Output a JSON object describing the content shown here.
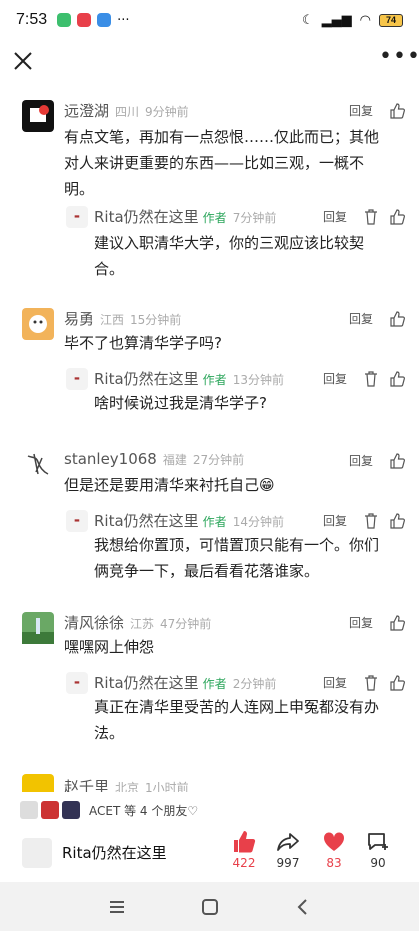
{
  "status": {
    "time": "7:53",
    "battery": "74"
  },
  "comments": [
    {
      "name": "远澄湖",
      "location": "四川",
      "time": "9分钟前",
      "reply_label": "回复",
      "text": [
        "有点文笔，再加有一点怨恨……仅此而已；其他",
        "对人来讲更重要的东西——比如三观，一概不",
        "明。"
      ],
      "reply": {
        "name": "Rita仍然在这里",
        "tag": "作者",
        "time": "7分钟前",
        "reply_label": "回复",
        "text": [
          "建议入职清华大学，你的三观应该比较契",
          "合。"
        ]
      }
    },
    {
      "name": "易勇",
      "location": "江西",
      "time": "15分钟前",
      "reply_label": "回复",
      "text": [
        "毕不了也算清华学子吗?"
      ],
      "reply": {
        "name": "Rita仍然在这里",
        "tag": "作者",
        "time": "13分钟前",
        "reply_label": "回复",
        "text": [
          "啥时候说过我是清华学子?"
        ]
      }
    },
    {
      "name": "stanley1068",
      "location": "福建",
      "time": "27分钟前",
      "reply_label": "回复",
      "text": [
        "但是还是要用清华来衬托自己😁"
      ],
      "reply": {
        "name": "Rita仍然在这里",
        "tag": "作者",
        "time": "14分钟前",
        "reply_label": "回复",
        "text": [
          "我想给你置顶，可惜置顶只能有一个。你们",
          "俩竞争一下，最后看看花落谁家。"
        ]
      }
    },
    {
      "name": "清风徐徐",
      "location": "江苏",
      "time": "47分钟前",
      "reply_label": "回复",
      "text": [
        "嘿嘿网上伸怨"
      ],
      "reply": {
        "name": "Rita仍然在这里",
        "tag": "作者",
        "time": "2分钟前",
        "reply_label": "回复",
        "text": [
          "真正在清华里受苦的人连网上申冤都没有办",
          "法。"
        ]
      }
    },
    {
      "name": "赵千里",
      "location": "北京",
      "time": "1小时前"
    }
  ],
  "friends_text": "ACET 等 4 个朋友♡",
  "author": {
    "name": "Rita仍然在这里"
  },
  "stats": {
    "likes": "422",
    "shares": "997",
    "favorites": "83",
    "comments": "90"
  },
  "colors": {
    "accent_green": "#2aa55a",
    "like_red": "#e8404a"
  }
}
